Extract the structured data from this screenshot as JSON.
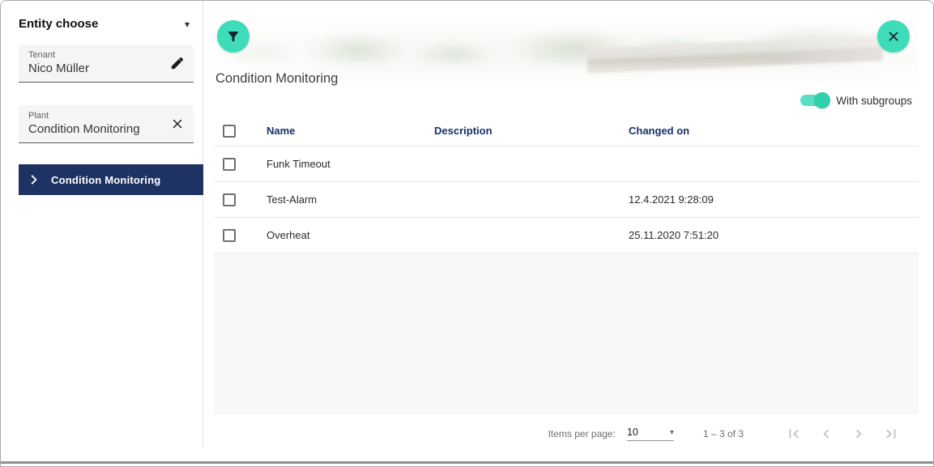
{
  "sidebar": {
    "title": "Entity choose",
    "tenant": {
      "label": "Tenant",
      "value": "Nico Müller"
    },
    "plant": {
      "label": "Plant",
      "value": "Condition Monitoring"
    },
    "tree_selected_item": "Condition Monitoring"
  },
  "main": {
    "title": "Condition Monitoring",
    "subgroups_toggle": {
      "label": "With subgroups",
      "state": "on"
    },
    "table": {
      "columns": {
        "name": "Name",
        "description": "Description",
        "changed_on": "Changed on"
      },
      "rows": [
        {
          "name": "Funk Timeout",
          "description": "",
          "changed_on": ""
        },
        {
          "name": "Test-Alarm",
          "description": "",
          "changed_on": "12.4.2021 9:28:09"
        },
        {
          "name": "Overheat",
          "description": "",
          "changed_on": "25.11.2020 7:51:20"
        }
      ]
    },
    "paginator": {
      "items_per_page_label": "Items per page:",
      "page_size": "10",
      "range_label": "1 – 3 of 3"
    }
  },
  "icons": {
    "caret_down": "▾",
    "select_caret": "▾",
    "filter": "funnel-icon",
    "close": "x-icon",
    "edit": "pencil-icon",
    "clear": "x-icon",
    "chevron_right": "chevron-right-icon"
  },
  "colors": {
    "accent_teal": "#3edcb9",
    "navy": "#1e3263",
    "table_header_text": "#17306b"
  }
}
